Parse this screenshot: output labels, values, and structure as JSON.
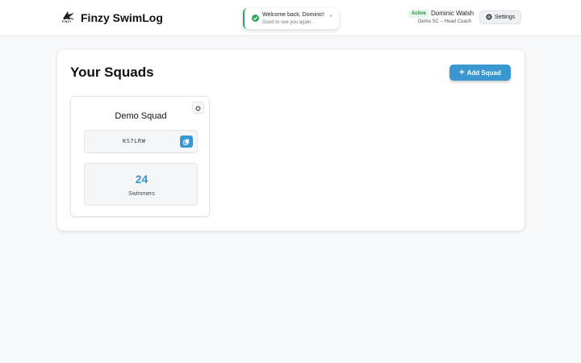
{
  "header": {
    "logo_text": "FINZY",
    "app_name": "Finzy SwimLog",
    "status_badge": "Active",
    "user_name": "Dominic Walsh",
    "user_role": "Demo SC – Head Coach",
    "settings_label": "Settings"
  },
  "toast": {
    "title": "Welcome back, Dominic!",
    "message": "Good to see you again.",
    "close": "×"
  },
  "main": {
    "title": "Your Squads",
    "add_label": "Add Squad",
    "squads": [
      {
        "name": "Demo Squad",
        "code": "KS7LRW",
        "swimmer_count": "24",
        "swimmer_label": "Swimmers"
      }
    ]
  },
  "colors": {
    "accent": "#3a97d0",
    "success": "#2fa65a",
    "background": "#f7f8fa"
  }
}
